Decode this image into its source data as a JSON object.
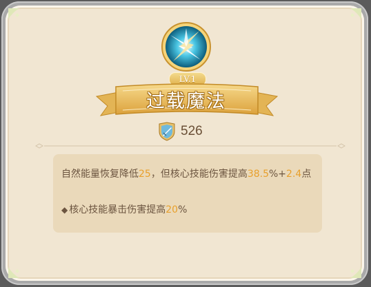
{
  "skill": {
    "level": "LV.1",
    "name": "过载魔法",
    "power": "526"
  },
  "description": {
    "line1": {
      "t1": "自然能量恢复降低",
      "v1": "25",
      "t2": "，但核心技能伤害提高",
      "v2": "38.5",
      "t3": "%+",
      "v3": "2.4",
      "t4": "点"
    },
    "line2": {
      "bullet": "◆",
      "t1": "核心技能暴击伤害提高",
      "v1": "20",
      "t2": "%"
    }
  },
  "colors": {
    "highlight": "#e8a02c",
    "text": "#6c5540",
    "panel": "#f1e6d2",
    "box": "#ead9ba",
    "gold": "#e0b24d"
  },
  "icons": {
    "skill": "lightning-orb-icon",
    "power": "shield-sword-icon"
  }
}
